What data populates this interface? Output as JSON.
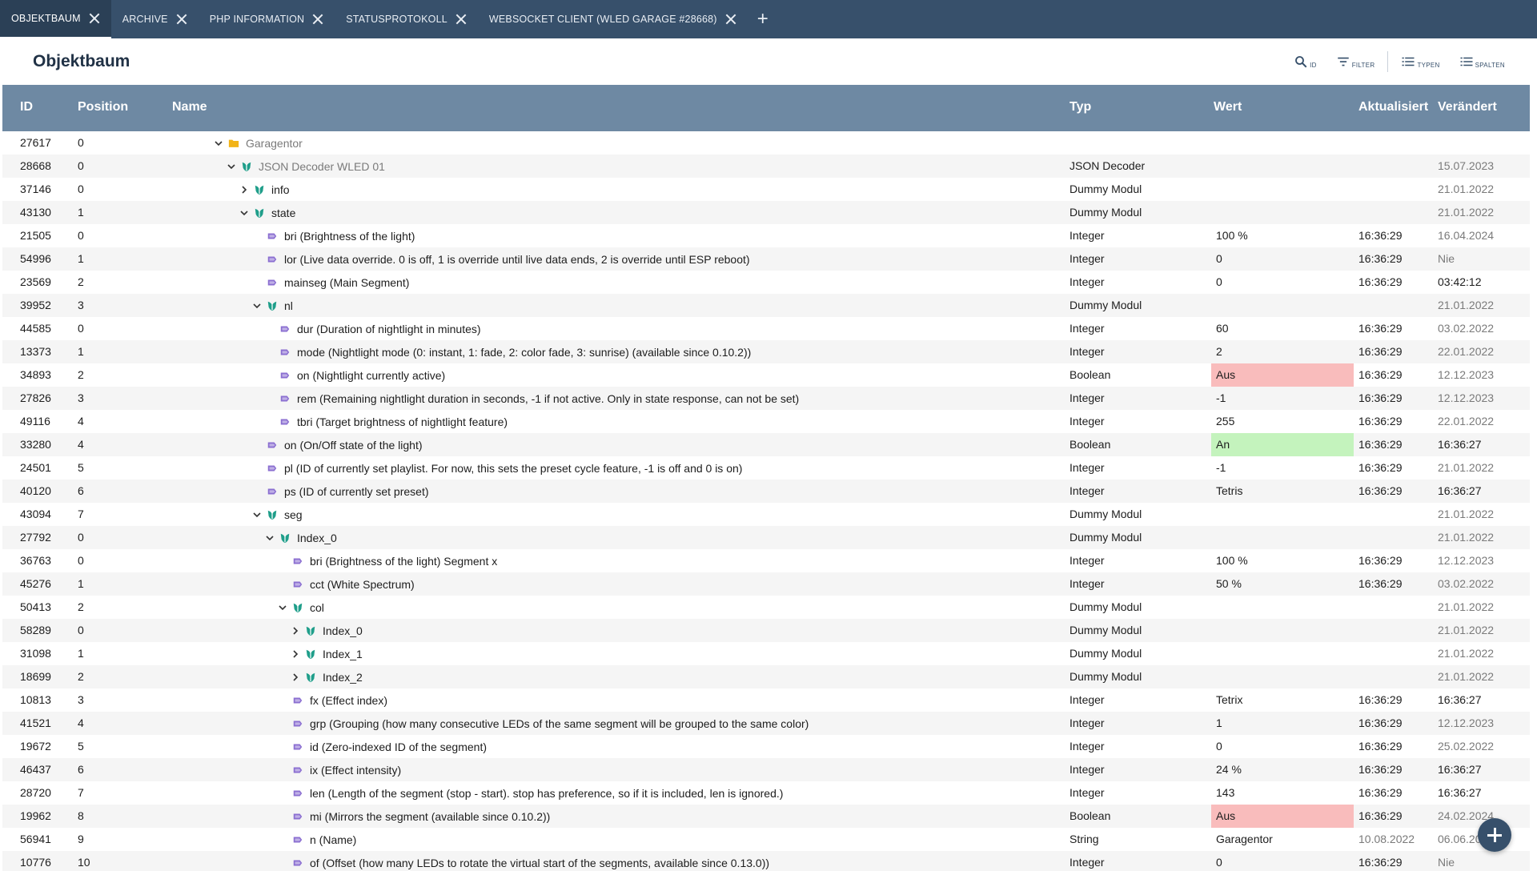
{
  "tabs": [
    {
      "label": "OBJEKTBAUM",
      "active": true
    },
    {
      "label": "ARCHIVE",
      "active": false
    },
    {
      "label": "PHP INFORMATION",
      "active": false
    },
    {
      "label": "STATUSPROTOKOLL",
      "active": false
    },
    {
      "label": "WEBSOCKET CLIENT (WLED GARAGE #28668)",
      "active": false
    }
  ],
  "add_tab_label": "+",
  "header": {
    "title": "Objektbaum",
    "tools": [
      {
        "label": "ID",
        "icon": "search-icon"
      },
      {
        "label": "FILTER",
        "icon": "filter-icon"
      },
      {
        "label": "TYPEN",
        "icon": "list-icon"
      },
      {
        "label": "SPALTEN",
        "icon": "list-icon"
      }
    ]
  },
  "columns": {
    "id": "ID",
    "position": "Position",
    "name": "Name",
    "typ": "Typ",
    "wert": "Wert",
    "aktualisiert": "Aktualisiert",
    "veraendert": "Verändert"
  },
  "colors": {
    "tabbar": "#37506b",
    "table_header": "#6e89a3",
    "value_off": "#f9bcbc",
    "value_on": "#c4f3bd",
    "folder": "#f2b418",
    "module": "#1f9e8a",
    "variable": "#8b6fd1"
  },
  "rows": [
    {
      "id": "27617",
      "pos": "0",
      "depth": 0,
      "expander": "open",
      "icon": "folder-icon",
      "name": "Garagentor",
      "name_muted": true,
      "typ": "",
      "wert": "",
      "wert_state": "",
      "akt": "",
      "akt_muted": false,
      "ver": "",
      "ver_muted": true
    },
    {
      "id": "28668",
      "pos": "0",
      "depth": 1,
      "expander": "open",
      "icon": "module-icon",
      "name": "JSON Decoder WLED 01",
      "name_muted": true,
      "typ": "JSON Decoder",
      "wert": "",
      "wert_state": "",
      "akt": "",
      "akt_muted": false,
      "ver": "15.07.2023",
      "ver_muted": true
    },
    {
      "id": "37146",
      "pos": "0",
      "depth": 2,
      "expander": "closed",
      "icon": "module-icon",
      "name": "info",
      "name_muted": false,
      "typ": "Dummy Modul",
      "wert": "",
      "wert_state": "",
      "akt": "",
      "akt_muted": false,
      "ver": "21.01.2022",
      "ver_muted": true
    },
    {
      "id": "43130",
      "pos": "1",
      "depth": 2,
      "expander": "open",
      "icon": "module-icon",
      "name": "state",
      "name_muted": false,
      "typ": "Dummy Modul",
      "wert": "",
      "wert_state": "",
      "akt": "",
      "akt_muted": false,
      "ver": "21.01.2022",
      "ver_muted": true
    },
    {
      "id": "21505",
      "pos": "0",
      "depth": 3,
      "expander": "none",
      "icon": "variable-icon",
      "name": "bri (Brightness of the light)",
      "name_muted": false,
      "typ": "Integer",
      "wert": "100 %",
      "wert_state": "",
      "akt": "16:36:29",
      "akt_muted": false,
      "ver": "16.04.2024",
      "ver_muted": true
    },
    {
      "id": "54996",
      "pos": "1",
      "depth": 3,
      "expander": "none",
      "icon": "variable-icon",
      "name": "lor (Live data override. 0 is off, 1 is override until live data ends, 2 is override until ESP reboot)",
      "name_muted": false,
      "typ": "Integer",
      "wert": "0",
      "wert_state": "",
      "akt": "16:36:29",
      "akt_muted": false,
      "ver": "Nie",
      "ver_muted": true
    },
    {
      "id": "23569",
      "pos": "2",
      "depth": 3,
      "expander": "none",
      "icon": "variable-icon",
      "name": "mainseg (Main Segment)",
      "name_muted": false,
      "typ": "Integer",
      "wert": "0",
      "wert_state": "",
      "akt": "16:36:29",
      "akt_muted": false,
      "ver": "03:42:12",
      "ver_muted": false
    },
    {
      "id": "39952",
      "pos": "3",
      "depth": 3,
      "expander": "open",
      "icon": "module-icon",
      "name": "nl",
      "name_muted": false,
      "typ": "Dummy Modul",
      "wert": "",
      "wert_state": "",
      "akt": "",
      "akt_muted": false,
      "ver": "21.01.2022",
      "ver_muted": true
    },
    {
      "id": "44585",
      "pos": "0",
      "depth": 4,
      "expander": "none",
      "icon": "variable-icon",
      "name": "dur (Duration of nightlight in minutes)",
      "name_muted": false,
      "typ": "Integer",
      "wert": "60",
      "wert_state": "",
      "akt": "16:36:29",
      "akt_muted": false,
      "ver": "03.02.2022",
      "ver_muted": true
    },
    {
      "id": "13373",
      "pos": "1",
      "depth": 4,
      "expander": "none",
      "icon": "variable-icon",
      "name": "mode (Nightlight mode (0: instant, 1: fade, 2: color fade, 3: sunrise) (available since 0.10.2))",
      "name_muted": false,
      "typ": "Integer",
      "wert": "2",
      "wert_state": "",
      "akt": "16:36:29",
      "akt_muted": false,
      "ver": "22.01.2022",
      "ver_muted": true
    },
    {
      "id": "34893",
      "pos": "2",
      "depth": 4,
      "expander": "none",
      "icon": "variable-icon",
      "name": "on (Nightlight currently active)",
      "name_muted": false,
      "typ": "Boolean",
      "wert": "Aus",
      "wert_state": "off",
      "akt": "16:36:29",
      "akt_muted": false,
      "ver": "12.12.2023",
      "ver_muted": true
    },
    {
      "id": "27826",
      "pos": "3",
      "depth": 4,
      "expander": "none",
      "icon": "variable-icon",
      "name": "rem (Remaining nightlight duration in seconds, -1 if not active. Only in state response, can not be set)",
      "name_muted": false,
      "typ": "Integer",
      "wert": "-1",
      "wert_state": "",
      "akt": "16:36:29",
      "akt_muted": false,
      "ver": "12.12.2023",
      "ver_muted": true
    },
    {
      "id": "49116",
      "pos": "4",
      "depth": 4,
      "expander": "none",
      "icon": "variable-icon",
      "name": "tbri (Target brightness of nightlight feature)",
      "name_muted": false,
      "typ": "Integer",
      "wert": "255",
      "wert_state": "",
      "akt": "16:36:29",
      "akt_muted": false,
      "ver": "22.01.2022",
      "ver_muted": true
    },
    {
      "id": "33280",
      "pos": "4",
      "depth": 3,
      "expander": "none",
      "icon": "variable-icon",
      "name": "on (On/Off state of the light)",
      "name_muted": false,
      "typ": "Boolean",
      "wert": "An",
      "wert_state": "on",
      "akt": "16:36:29",
      "akt_muted": false,
      "ver": "16:36:27",
      "ver_muted": false
    },
    {
      "id": "24501",
      "pos": "5",
      "depth": 3,
      "expander": "none",
      "icon": "variable-icon",
      "name": "pl (ID of currently set playlist. For now, this sets the preset cycle feature, -1 is off and 0 is on)",
      "name_muted": false,
      "typ": "Integer",
      "wert": "-1",
      "wert_state": "",
      "akt": "16:36:29",
      "akt_muted": false,
      "ver": "21.01.2022",
      "ver_muted": true
    },
    {
      "id": "40120",
      "pos": "6",
      "depth": 3,
      "expander": "none",
      "icon": "variable-icon",
      "name": "ps (ID of currently set preset)",
      "name_muted": false,
      "typ": "Integer",
      "wert": "Tetris",
      "wert_state": "",
      "akt": "16:36:29",
      "akt_muted": false,
      "ver": "16:36:27",
      "ver_muted": false
    },
    {
      "id": "43094",
      "pos": "7",
      "depth": 3,
      "expander": "open",
      "icon": "module-icon",
      "name": "seg",
      "name_muted": false,
      "typ": "Dummy Modul",
      "wert": "",
      "wert_state": "",
      "akt": "",
      "akt_muted": false,
      "ver": "21.01.2022",
      "ver_muted": true
    },
    {
      "id": "27792",
      "pos": "0",
      "depth": 4,
      "expander": "open",
      "icon": "module-icon",
      "name": "Index_0",
      "name_muted": false,
      "typ": "Dummy Modul",
      "wert": "",
      "wert_state": "",
      "akt": "",
      "akt_muted": false,
      "ver": "21.01.2022",
      "ver_muted": true
    },
    {
      "id": "36763",
      "pos": "0",
      "depth": 5,
      "expander": "none",
      "icon": "variable-icon",
      "name": "bri (Brightness of the light) Segment x",
      "name_muted": false,
      "typ": "Integer",
      "wert": "100 %",
      "wert_state": "",
      "akt": "16:36:29",
      "akt_muted": false,
      "ver": "12.12.2023",
      "ver_muted": true
    },
    {
      "id": "45276",
      "pos": "1",
      "depth": 5,
      "expander": "none",
      "icon": "variable-icon",
      "name": "cct (White Spectrum)",
      "name_muted": false,
      "typ": "Integer",
      "wert": "50 %",
      "wert_state": "",
      "akt": "16:36:29",
      "akt_muted": false,
      "ver": "03.02.2022",
      "ver_muted": true
    },
    {
      "id": "50413",
      "pos": "2",
      "depth": 5,
      "expander": "open",
      "icon": "module-icon",
      "name": "col",
      "name_muted": false,
      "typ": "Dummy Modul",
      "wert": "",
      "wert_state": "",
      "akt": "",
      "akt_muted": false,
      "ver": "21.01.2022",
      "ver_muted": true
    },
    {
      "id": "58289",
      "pos": "0",
      "depth": 6,
      "expander": "closed",
      "icon": "module-icon",
      "name": "Index_0",
      "name_muted": false,
      "typ": "Dummy Modul",
      "wert": "",
      "wert_state": "",
      "akt": "",
      "akt_muted": false,
      "ver": "21.01.2022",
      "ver_muted": true
    },
    {
      "id": "31098",
      "pos": "1",
      "depth": 6,
      "expander": "closed",
      "icon": "module-icon",
      "name": "Index_1",
      "name_muted": false,
      "typ": "Dummy Modul",
      "wert": "",
      "wert_state": "",
      "akt": "",
      "akt_muted": false,
      "ver": "21.01.2022",
      "ver_muted": true
    },
    {
      "id": "18699",
      "pos": "2",
      "depth": 6,
      "expander": "closed",
      "icon": "module-icon",
      "name": "Index_2",
      "name_muted": false,
      "typ": "Dummy Modul",
      "wert": "",
      "wert_state": "",
      "akt": "",
      "akt_muted": false,
      "ver": "21.01.2022",
      "ver_muted": true
    },
    {
      "id": "10813",
      "pos": "3",
      "depth": 5,
      "expander": "none",
      "icon": "variable-icon",
      "name": "fx (Effect index)",
      "name_muted": false,
      "typ": "Integer",
      "wert": "Tetrix",
      "wert_state": "",
      "akt": "16:36:29",
      "akt_muted": false,
      "ver": "16:36:27",
      "ver_muted": false
    },
    {
      "id": "41521",
      "pos": "4",
      "depth": 5,
      "expander": "none",
      "icon": "variable-icon",
      "name": "grp (Grouping (how many consecutive LEDs of the same segment will be grouped to the same color)",
      "name_muted": false,
      "typ": "Integer",
      "wert": "1",
      "wert_state": "",
      "akt": "16:36:29",
      "akt_muted": false,
      "ver": "12.12.2023",
      "ver_muted": true
    },
    {
      "id": "19672",
      "pos": "5",
      "depth": 5,
      "expander": "none",
      "icon": "variable-icon",
      "name": "id (Zero-indexed ID of the segment)",
      "name_muted": false,
      "typ": "Integer",
      "wert": "0",
      "wert_state": "",
      "akt": "16:36:29",
      "akt_muted": false,
      "ver": "25.02.2022",
      "ver_muted": true
    },
    {
      "id": "46437",
      "pos": "6",
      "depth": 5,
      "expander": "none",
      "icon": "variable-icon",
      "name": "ix (Effect intensity)",
      "name_muted": false,
      "typ": "Integer",
      "wert": "24 %",
      "wert_state": "",
      "akt": "16:36:29",
      "akt_muted": false,
      "ver": "16:36:27",
      "ver_muted": false
    },
    {
      "id": "28720",
      "pos": "7",
      "depth": 5,
      "expander": "none",
      "icon": "variable-icon",
      "name": "len (Length of the segment (stop - start). stop has preference, so if it is included, len is ignored.)",
      "name_muted": false,
      "typ": "Integer",
      "wert": "143",
      "wert_state": "",
      "akt": "16:36:29",
      "akt_muted": false,
      "ver": "16:36:27",
      "ver_muted": false
    },
    {
      "id": "19962",
      "pos": "8",
      "depth": 5,
      "expander": "none",
      "icon": "variable-icon",
      "name": "mi (Mirrors the segment (available since 0.10.2))",
      "name_muted": false,
      "typ": "Boolean",
      "wert": "Aus",
      "wert_state": "off",
      "akt": "16:36:29",
      "akt_muted": false,
      "ver": "24.02.2024",
      "ver_muted": true
    },
    {
      "id": "56941",
      "pos": "9",
      "depth": 5,
      "expander": "none",
      "icon": "variable-icon",
      "name": "n (Name)",
      "name_muted": false,
      "typ": "String",
      "wert": "Garagentor",
      "wert_state": "",
      "akt": "10.08.2022",
      "akt_muted": true,
      "ver": "06.06.2024",
      "ver_muted": true
    },
    {
      "id": "10776",
      "pos": "10",
      "depth": 5,
      "expander": "none",
      "icon": "variable-icon",
      "name": "of (Offset (how many LEDs to rotate the virtual start of the segments, available since 0.13.0))",
      "name_muted": false,
      "typ": "Integer",
      "wert": "0",
      "wert_state": "",
      "akt": "16:36:29",
      "akt_muted": false,
      "ver": "Nie",
      "ver_muted": true
    }
  ]
}
